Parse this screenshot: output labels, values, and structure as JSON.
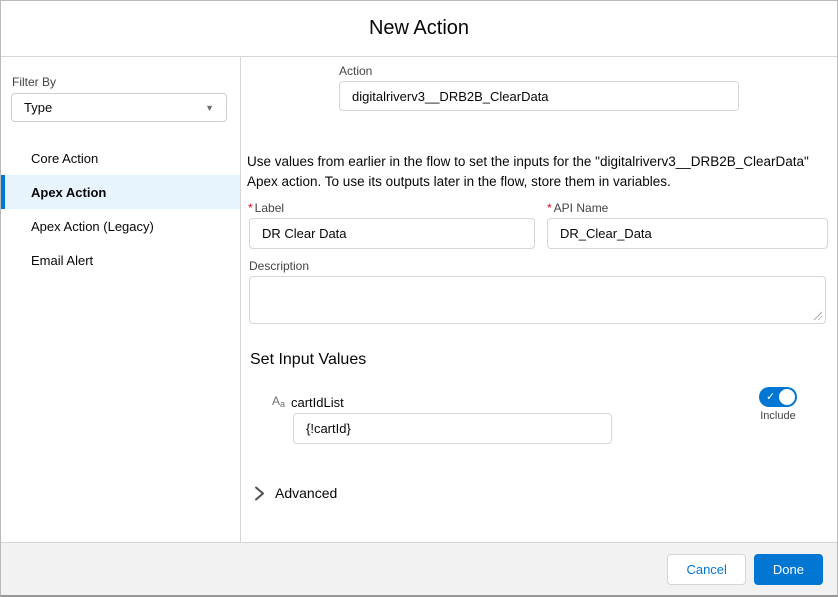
{
  "dialog": {
    "title": "New Action"
  },
  "sidebar": {
    "filter_label": "Filter By",
    "filter_value": "Type",
    "items": [
      {
        "label": "Core Action",
        "selected": false
      },
      {
        "label": "Apex Action",
        "selected": true
      },
      {
        "label": "Apex Action (Legacy)",
        "selected": false
      },
      {
        "label": "Email Alert",
        "selected": false
      }
    ]
  },
  "form": {
    "action_field": {
      "label": "Action",
      "value": "digitalriverv3__DRB2B_ClearData"
    },
    "intro_text": "Use values from earlier in the flow to set the inputs for the \"digitalriverv3__DRB2B_ClearData\" Apex action. To use its outputs later in the flow, store them in variables.",
    "label_field": {
      "required_mark": "*",
      "label": "Label",
      "value": "DR Clear Data"
    },
    "api_name_field": {
      "required_mark": "*",
      "label": "API Name",
      "value": "DR_Clear_Data"
    },
    "description_field": {
      "label": "Description",
      "value": ""
    },
    "section_heading": "Set Input Values",
    "input_param": {
      "type_icon_cap": "A",
      "type_icon_small": "a",
      "name": "cartIdList",
      "value": "{!cartId}",
      "toggle_label": "Include",
      "toggle_on": true
    },
    "advanced_label": "Advanced"
  },
  "footer": {
    "cancel_label": "Cancel",
    "done_label": "Done"
  },
  "colors": {
    "accent_blue": "#0176d3",
    "selected_item_bg": "#e8f4fd",
    "required_red": "#ea001e",
    "footer_bg": "#f3f2f2"
  }
}
